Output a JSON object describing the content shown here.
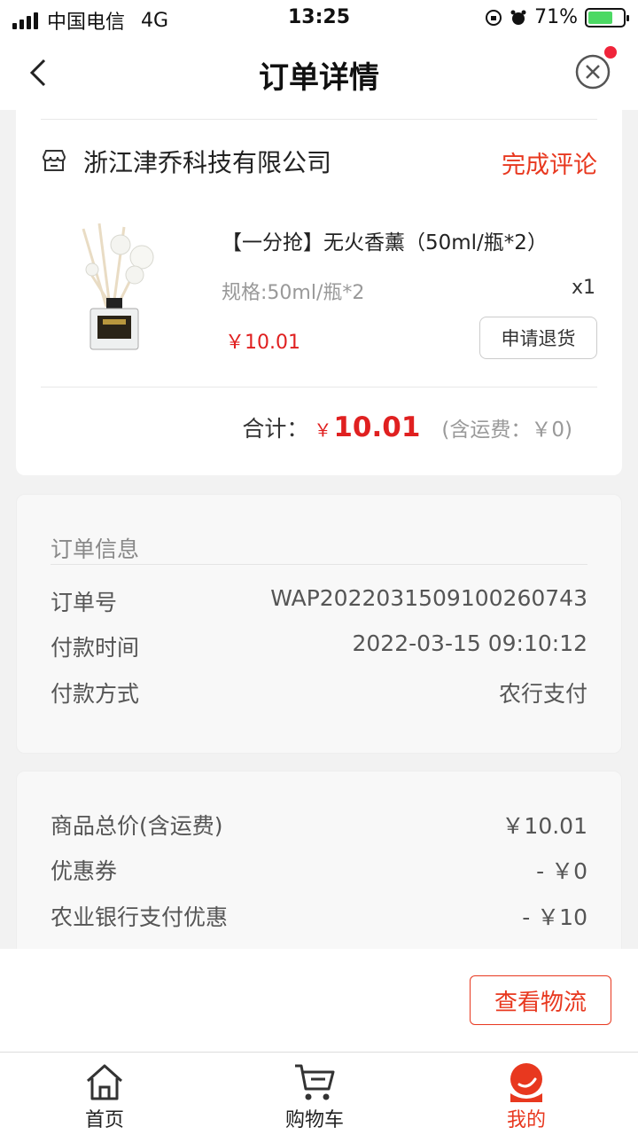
{
  "status_bar": {
    "carrier": "中国电信",
    "network": "4G",
    "time": "13:25",
    "battery": "71%",
    "battery_level": 0.71
  },
  "nav": {
    "title": "订单详情",
    "back_icon": "chevron-left-icon",
    "close_icon": "close-circle-icon"
  },
  "order": {
    "store_name": "浙江津乔科技有限公司",
    "review_label": "完成评论",
    "product": {
      "title": "【一分抢】无火香薰（50ml/瓶*2）",
      "spec": "规格:50ml/瓶*2",
      "quantity": "x1",
      "price": "￥10.01",
      "return_label": "申请退货"
    },
    "total_label": "合计：",
    "total_currency": "￥",
    "total_amount": "10.01",
    "total_shipping": "(含运费：￥0)"
  },
  "order_info": {
    "title": "订单信息",
    "rows": [
      {
        "label": "订单号",
        "value": "WAP2022031509100260743"
      },
      {
        "label": "付款时间",
        "value": "2022-03-15 09:10:12"
      },
      {
        "label": "付款方式",
        "value": "农行支付"
      }
    ]
  },
  "price_info": {
    "rows": [
      {
        "label": "商品总价(含运费)",
        "value": "￥10.01"
      },
      {
        "label": "优惠券",
        "value": "- ￥0"
      },
      {
        "label": "农业银行支付优惠",
        "value": "- ￥10"
      }
    ]
  },
  "actions": {
    "logistics_label": "查看物流"
  },
  "tabbar": {
    "items": [
      {
        "label": "首页",
        "icon": "home-icon"
      },
      {
        "label": "购物车",
        "icon": "cart-icon"
      },
      {
        "label": "我的",
        "icon": "profile-icon"
      }
    ]
  },
  "colors": {
    "accent": "#e8381f",
    "price": "#e02020",
    "background": "#f2f2f2"
  }
}
